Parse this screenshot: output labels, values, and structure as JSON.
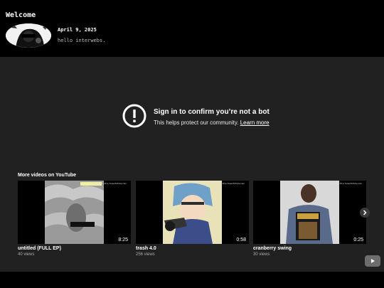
{
  "header": {
    "title": "Welcome",
    "post_date": "April 9, 2025",
    "post_text": "hello interwebs."
  },
  "embed": {
    "alert_icon": "exclamation-circle-icon",
    "alert_title": "Sign in to confirm you’re not a bot",
    "alert_desc": "This helps protect our community. ",
    "alert_link": "Learn more",
    "more_videos_title": "More videos on YouTube",
    "watermark_text": "uploaded to 4K ▸ TunesToTube.com",
    "videos": [
      {
        "title": "untitled (FULL EP)",
        "views": "40 views",
        "duration": "8:25"
      },
      {
        "title": "trash 4.0",
        "views": "256 views",
        "duration": "0:58"
      },
      {
        "title": "cranberry swing",
        "views": "30 views",
        "duration": "0:25"
      }
    ],
    "next_icon": "chevron-right-icon",
    "logo_icon": "youtube-logo-icon"
  },
  "colors": {
    "page_bg": "#000000",
    "player_bg": "#212121",
    "text_primary": "#ffffff",
    "text_secondary": "#aaaaaa"
  }
}
